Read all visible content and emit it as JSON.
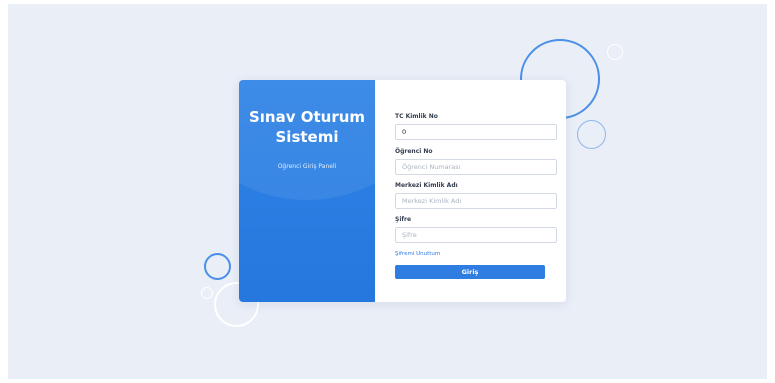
{
  "brand": {
    "title": "Sınav Oturum Sistemi",
    "subtitle": "Öğrenci Giriş Paneli"
  },
  "form": {
    "tc": {
      "label": "TC Kimlik No",
      "value": "0"
    },
    "student_no": {
      "label": "Öğrenci No",
      "placeholder": "Öğrenci Numarası"
    },
    "central_id": {
      "label": "Merkezi Kimlik Adı",
      "placeholder": "Merkezi Kimlik Adı"
    },
    "password": {
      "label": "Şifre",
      "placeholder": "Şifre"
    },
    "forgot_label": "Şifremi Unuttum",
    "submit_label": "Giriş"
  },
  "colors": {
    "primary": "#2f7de1",
    "background": "#e9eef7",
    "panel": "#2677de"
  }
}
